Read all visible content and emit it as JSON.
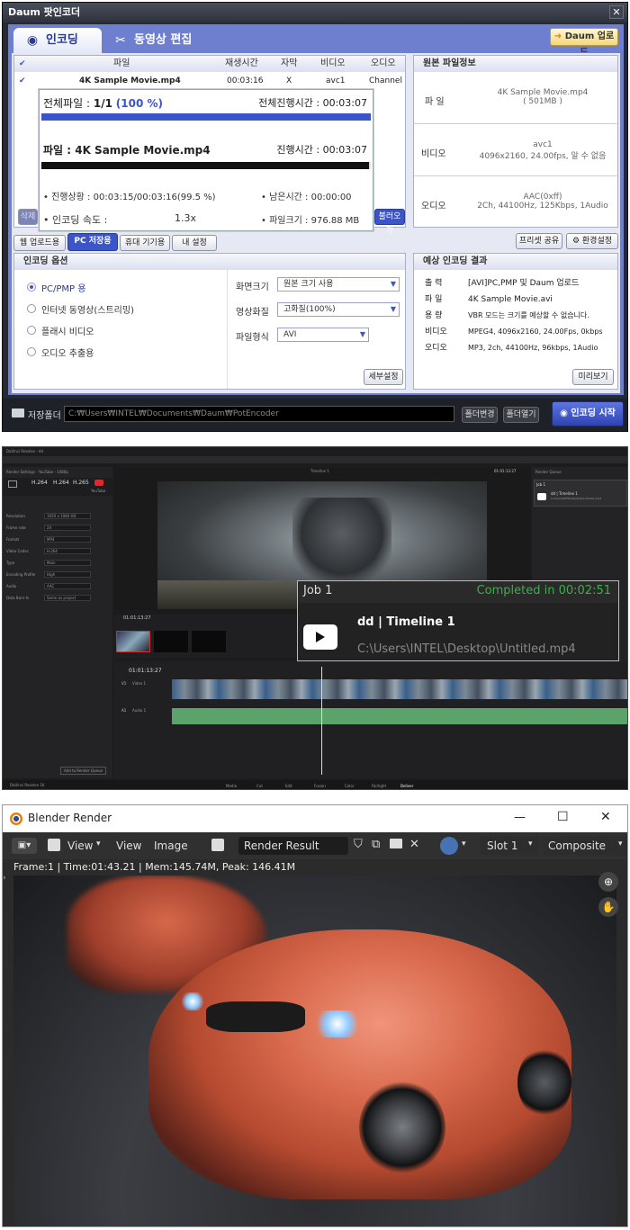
{
  "potencoder": {
    "title": "Daum 팟인코더",
    "close_glyph": "✕",
    "tabs": [
      {
        "label": "인코딩",
        "icon": "disc-icon"
      },
      {
        "label": "동영상 편집",
        "icon": "scissors-icon"
      }
    ],
    "daum_upload": "Daum 업로드",
    "file_table": {
      "headers": [
        "파일",
        "재생시간",
        "자막",
        "비디오",
        "오디오"
      ],
      "row": {
        "name": "4K Sample Movie.mp4",
        "duration": "00:03:16",
        "subtitle": "X",
        "video": "avc1",
        "audio": "Channel 1"
      }
    },
    "progress": {
      "total_files_label": "전체파일 :",
      "total_files_value": "1/1",
      "total_files_pct": "(100 %)",
      "total_time_label": "전체진행시간 :",
      "total_time_value": "00:03:07",
      "total_fraction": 1.0,
      "file_label": "파일 : 4K Sample Movie.mp4",
      "file_time_label": "진행시간 :",
      "file_time_value": "00:03:07",
      "file_fraction": 0.995,
      "status_label": "• 진행상황 :",
      "status_value": "00:03:15/00:03:16(99.5 %)",
      "remain_label": "• 남은시간 :",
      "remain_value": "00:00:00",
      "speed_label": "• 인코딩 속도 :",
      "speed_value": "1.3x",
      "size_label": "• 파일크기 :",
      "size_value": "976.88 MB"
    },
    "hidden_btn_left": "삭제",
    "hidden_btn_right": "불러오기",
    "source_info": {
      "title": "원본 파일정보",
      "rows": [
        {
          "k": "파 일",
          "v1": "4K Sample Movie.mp4",
          "v2": "( 501MB )"
        },
        {
          "k": "비디오",
          "v1": "avc1",
          "v2": "4096x2160, 24.00fps, 알 수 없음"
        },
        {
          "k": "오디오",
          "v1": "AAC(0xff)",
          "v2": "2Ch, 44100Hz, 125Kbps, 1Audio"
        }
      ]
    },
    "subtabs": [
      "웹 업로드용",
      "PC 저장용",
      "휴대 기기용",
      "내 설정"
    ],
    "active_subtab": 1,
    "preset_share": "프리셋 공유",
    "settings": "환경설정",
    "options": {
      "title": "인코딩 옵션",
      "radios": [
        "PC/PMP 용",
        "인터넷 동영상(스트리밍)",
        "플래시 비디오",
        "오디오 추출용"
      ],
      "selected": 0,
      "fields": [
        {
          "label": "화면크기",
          "value": "원본 크기 사용"
        },
        {
          "label": "영상화질",
          "value": "고화질(100%)"
        },
        {
          "label": "파일형식",
          "value": "AVI"
        }
      ],
      "detail_btn": "세부설정"
    },
    "expected": {
      "title": "예상 인코딩 결과",
      "rows": [
        {
          "k": "출 력",
          "v": "[AVI]PC,PMP 및 Daum 업로드"
        },
        {
          "k": "파 일",
          "v": "4K Sample Movie.avi"
        },
        {
          "k": "용 량",
          "v": "VBR 모드는 크기를 예상할 수 없습니다."
        },
        {
          "k": "비디오",
          "v": "MPEG4, 4096x2160, 24.00Fps, 0kbps"
        },
        {
          "k": "오디오",
          "v": "MP3, 2ch, 44100Hz, 96kbps, 1Audio"
        }
      ],
      "preview_btn": "미리보기"
    },
    "save_folder_label": "저장폴더",
    "save_path": "C:₩Users₩INTEL₩Documents₩Daum₩PotEncoder",
    "change_folder": "폴더변경",
    "open_folder": "폴더열기",
    "start_btn": "인코딩 시작"
  },
  "davinci": {
    "app_label": "DaVinci Resolve - dd",
    "project_title": "dd",
    "render_settings_title": "Render Settings - YouTube - 1080p",
    "codec_tabs": [
      "H.264",
      "H.264",
      "H.265",
      "YouTube"
    ],
    "settings": [
      {
        "k": "Resolution",
        "v": "1920 x 1080 HD"
      },
      {
        "k": "Frame rate",
        "v": "24"
      },
      {
        "k": "Format",
        "v": "MP4"
      },
      {
        "k": "Video Codec",
        "v": "H.264"
      },
      {
        "k": "Type",
        "v": "Main"
      },
      {
        "k": "Encoding Profile",
        "v": "High"
      },
      {
        "k": "Audio",
        "v": "AAC"
      },
      {
        "k": "Data Burn-In",
        "v": "Same as project"
      }
    ],
    "add_queue_btn": "Add to Render Queue",
    "timeline_name": "Timeline 1",
    "timecode_top": "01:01:13:27",
    "timecode_track": "01:01:13:27",
    "queue_title": "Render Queue",
    "job": {
      "title": "Job 1",
      "status": "Completed in 00:02:51",
      "name": "dd | Timeline 1",
      "path": "C:\\Users\\INTEL\\Desktop\\Untitled.mp4"
    },
    "track_labels": [
      "V1",
      "A1"
    ],
    "track_names": [
      "Video 1",
      "Audio 1"
    ],
    "bottom_label": "DaVinci Resolve 16",
    "pages": [
      "Media",
      "Cut",
      "Edit",
      "Fusion",
      "Color",
      "Fairlight",
      "Deliver"
    ],
    "colors": {
      "completed": "#3fae49",
      "video_track": "#3a5f8a",
      "audio_track": "#5aa36a"
    }
  },
  "blender": {
    "title": "Blender Render",
    "menu": [
      "View",
      "View",
      "Image"
    ],
    "image_name": "Render Result",
    "slot": "Slot 1",
    "pass": "Composite",
    "stats": "Frame:1 | Time:01:43.21 | Mem:145.74M, Peak: 146.41M",
    "window_controls": [
      "—",
      "☐",
      "✕"
    ]
  }
}
